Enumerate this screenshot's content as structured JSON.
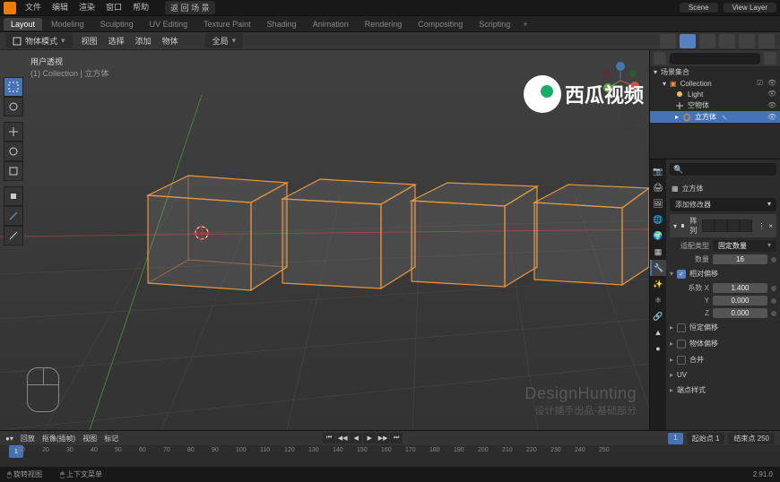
{
  "topmenu": {
    "file": "文件",
    "edit": "编辑",
    "render": "渲染",
    "window": "窗口",
    "help": "帮助",
    "back": "返 回 场 景"
  },
  "scene_field": "Scene",
  "viewlayer_field": "View Layer",
  "workspaces": [
    "Layout",
    "Modeling",
    "Sculpting",
    "UV Editing",
    "Texture Paint",
    "Shading",
    "Animation",
    "Rendering",
    "Compositing",
    "Scripting"
  ],
  "header3d": {
    "mode": "物体模式",
    "menus": [
      "视图",
      "选择",
      "添加",
      "物体"
    ],
    "global": "全局"
  },
  "viewport": {
    "title": "用户透视",
    "subtitle": "(1) Collection | 立方体"
  },
  "watermark": {
    "line1": "DesignHunting",
    "line2": "设计捕手出品·基础部分"
  },
  "xigua": "西瓜视频",
  "outliner": {
    "scene_coll": "场景集合",
    "collection": "Collection",
    "items": [
      {
        "name": "Light",
        "icon": "light"
      },
      {
        "name": "空物体",
        "icon": "empty"
      },
      {
        "name": "立方体",
        "icon": "mesh",
        "selected": true
      }
    ]
  },
  "props": {
    "breadcrumb": "立方体",
    "add_modifier": "添加修改器",
    "modifier": {
      "name": "阵列",
      "type_label": "阵列"
    },
    "fit_type": {
      "label": "适配类型",
      "value": "固定数量"
    },
    "count": {
      "label": "数量",
      "value": "16"
    },
    "relative_offset": {
      "header": "相对偏移",
      "factor_label": "系数 X",
      "x": "1.400",
      "y": "0.000",
      "z": "0.000"
    },
    "sections": [
      "恒定偏移",
      "物体偏移",
      "合并",
      "UV",
      "端点样式"
    ]
  },
  "timeline": {
    "menus": [
      "回放",
      "抠像(插帧)",
      "视图",
      "标记"
    ],
    "start_label": "起始点",
    "start": "1",
    "end_label": "结束点",
    "end": "250",
    "current": "1",
    "ticks": [
      "10",
      "20",
      "30",
      "40",
      "50",
      "60",
      "70",
      "80",
      "90",
      "100",
      "110",
      "120",
      "130",
      "140",
      "150",
      "160",
      "170",
      "180",
      "190",
      "200",
      "210",
      "220",
      "230",
      "240",
      "250"
    ]
  },
  "status": {
    "rotate": "旋转视图",
    "context": "上下文菜单",
    "version": "2.91.0"
  }
}
